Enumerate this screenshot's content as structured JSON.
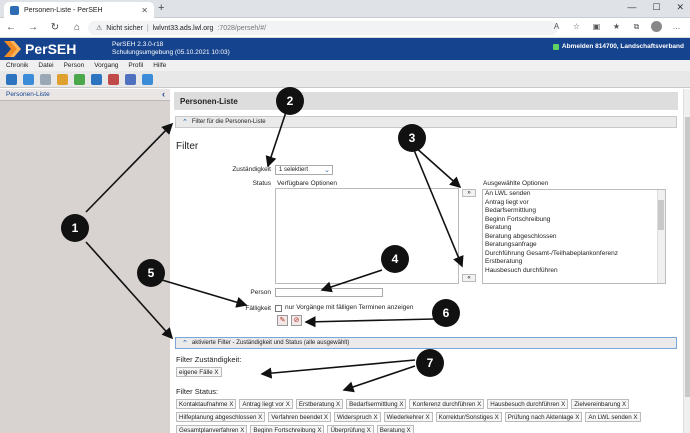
{
  "browser": {
    "tab_title": "Personen-Liste - PerSEH",
    "new_tab": "+",
    "security_label": "Nicht sicher",
    "url_host": "lwlvnt33.ads.lwl.org",
    "url_path": ":7028/perseh/#/"
  },
  "app": {
    "name": "PerSEH",
    "version_line": "PerSEH 2.3.0-r18",
    "env_line": "Schulungsumgebung (05.10.2021 10:03)",
    "logout": "Abmelden 814700, Landschaftsverband",
    "menu": [
      "Chronik",
      "Datei",
      "Person",
      "Vorgang",
      "Profil",
      "Hilfe"
    ],
    "toolbar_colors": [
      "#2d73c0",
      "#3b8cd8",
      "#9aa7b5",
      "#e0a030",
      "#4aa84a",
      "#2d73c0",
      "#c04a4a",
      "#4f71c0",
      "#3b8cd8"
    ]
  },
  "sidebar": {
    "title": "Personen-Liste",
    "collapse": "‹"
  },
  "main": {
    "page_title": "Personen-Liste",
    "filter_panel": "Filter für die Personen-Liste",
    "filter_heading": "Filter",
    "zustaendigkeit_label": "Zuständigkeit",
    "zustaendigkeit_value": "1 selektiert",
    "status_label": "Status",
    "available_header": "Verfügbare Optionen",
    "selected_header": "Ausgewählte Optionen",
    "move_right": "»",
    "move_left": "«",
    "selected_options": [
      "An LWL senden",
      "Antrag liegt vor",
      "Bedarfsermittlung",
      "Beginn Fortschreibung",
      "Beratung",
      "Beratung abgeschlossen",
      "Beratungsanfrage",
      "Durchführung Gesamt-/Teilhabeplankonferenz",
      "Erstberatung",
      "Hausbesuch durchführen"
    ],
    "person_label": "Person",
    "faelligkeit_label": "Fälligkeit",
    "faelligkeit_text": "nur Vorgänge mit fälligen Terminen anzeigen",
    "active_panel": "aktivierte Filter - Zuständigkeit und Status (alle ausgewählt)",
    "filter_zust_heading": "Filter Zuständigkeit:",
    "zust_chips": [
      "eigene Fälle X"
    ],
    "filter_status_heading": "Filter Status:",
    "status_chips": [
      "Kontaktaufnahme X",
      "Antrag liegt vor X",
      "Erstberatung X",
      "Bedarfsermittlung X",
      "Konferenz durchführen X",
      "Hausbesuch durchführen X",
      "Zielvereinbarung X",
      "Hilfeplanung abgeschlossen X",
      "Verfahren beendet X",
      "Widerspruch X",
      "Wiederkehrer X",
      "Korrektur/Sonstiges X",
      "Prüfung nach Aktenlage X",
      "An LWL senden X",
      "Gesamtplanverfahren X",
      "Beginn Fortschreibung X",
      "Überprüfung X",
      "Beratung X"
    ]
  },
  "annotations": [
    "1",
    "2",
    "3",
    "4",
    "5",
    "6",
    "7"
  ]
}
